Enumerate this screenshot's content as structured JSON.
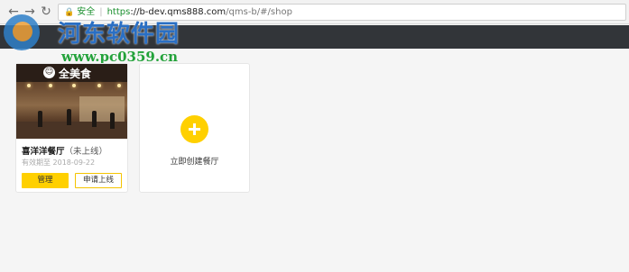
{
  "browser": {
    "back_icon": "arrow-left-icon",
    "forward_icon": "arrow-right-icon",
    "reload_icon": "reload-icon",
    "secure_label": "安全",
    "url_scheme": "https",
    "url_host": "://b-dev.qms888.com",
    "url_path": "/qms-b/#/shop"
  },
  "watermark": {
    "title": "河东软件园",
    "url": "www.pc0359.cn"
  },
  "store": {
    "image_sign": "全美食",
    "name": "喜洋洋餐厅",
    "status": "（未上线）",
    "expiry": "有效期至 2018-09-22",
    "manage_label": "管理",
    "apply_label": "申请上线"
  },
  "create": {
    "label": "立即创建餐厅",
    "icon": "plus-icon"
  },
  "colors": {
    "accent": "#ffd000",
    "app_bar": "#323539",
    "secure_green": "#1a8f2e"
  }
}
